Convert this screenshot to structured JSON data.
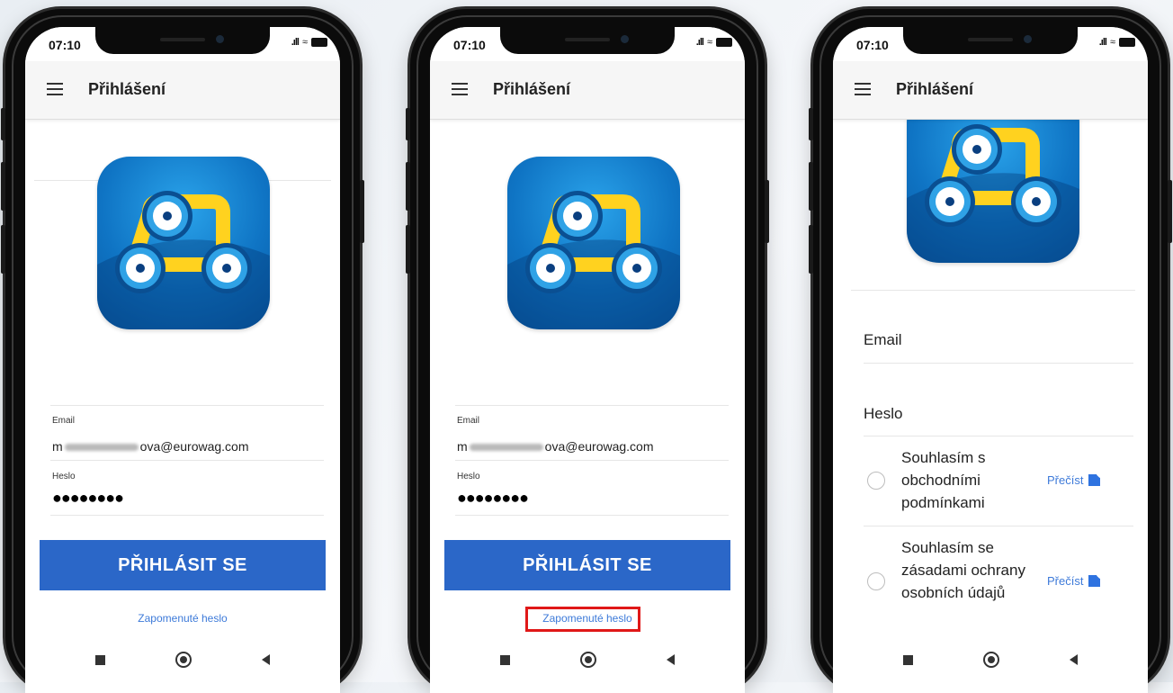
{
  "status": {
    "time": "07:10"
  },
  "appbar": {
    "title": "Přihlášení"
  },
  "screen1": {
    "email_label": "Email",
    "email_prefix": "m",
    "email_suffix": "ova@eurowag.com",
    "password_label": "Heslo",
    "password_dots": "●●●●●●●●",
    "login_button": "PŘIHLÁSIT SE",
    "forgot_link": "Zapomenuté heslo"
  },
  "screen2": {
    "email_label": "Email",
    "email_prefix": "m",
    "email_suffix": "ova@eurowag.com",
    "password_label": "Heslo",
    "password_dots": "●●●●●●●●",
    "login_button": "PŘIHLÁSIT SE",
    "forgot_link": "Zapomenuté heslo",
    "highlight_color": "#e01818"
  },
  "screen3": {
    "email_label": "Email",
    "password_label": "Heslo",
    "consents": [
      {
        "text": "Souhlasím s obchodními podmínkami",
        "link": "Přečíst"
      },
      {
        "text": "Souhlasím se zásadami ochrany osobních údajů",
        "link": "Přečíst"
      }
    ]
  },
  "colors": {
    "accent": "#2b67c8",
    "link": "#3d7ad9",
    "logo_blue": "#0f74c4",
    "logo_yellow": "#ffd21f"
  },
  "icons": [
    "menu-icon",
    "signal-icon",
    "wifi-icon",
    "battery-icon",
    "edit-icon",
    "nav-recents-icon",
    "nav-home-icon",
    "nav-back-icon"
  ]
}
